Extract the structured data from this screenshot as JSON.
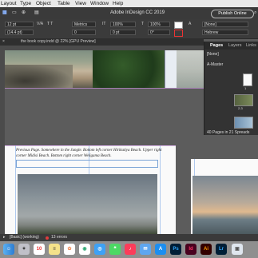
{
  "menubar": {
    "items": [
      "Layout",
      "Type",
      "Object",
      "Table",
      "View",
      "Window",
      "Help"
    ]
  },
  "titlebar": {
    "title": "Adobe InDesign CC 2019",
    "publish_label": "Publish Online"
  },
  "control": {
    "font_size": "12 pt",
    "leading": "(14.4 pt)",
    "kerning": "Metrics",
    "tracking": "0",
    "scale_v": "100%",
    "scale_h": "100%",
    "baseline": "0 pt",
    "skew": "0°",
    "char_style": "[None]",
    "language": "Hebrew"
  },
  "document_tab": {
    "label": "the book copy.indd @ 22% [GPU Preview]"
  },
  "pages_panel": {
    "tabs": [
      "Pages",
      "Layers",
      "Links"
    ],
    "none_label": "[None]",
    "master_label": "A-Master",
    "spread_label": "2-3",
    "page_count": "40 Pages in 21 Spreads"
  },
  "document": {
    "caption": "Previous Page. Somewhere in the Jungle. Bottom left corner Hirikatiya Beach. Upper right corner Midisi Beach. Bottom right corner Weligama Beach."
  },
  "status": {
    "style": "[Basic] (working)",
    "errors": "13 errors"
  },
  "dock": {
    "icons": [
      "finder-icon",
      "launchpad-icon",
      "calendar-icon",
      "notes-icon",
      "photos-icon",
      "chrome-icon",
      "safari-icon",
      "messages-icon",
      "music-icon",
      "mail-icon",
      "appstore-icon",
      "photoshop-icon",
      "indesign-icon",
      "illustrator-icon",
      "lightroom-icon",
      "preview-icon"
    ],
    "labels": {
      "calendar": "10",
      "photoshop": "Ps",
      "indesign": "Id",
      "illustrator": "Ai",
      "lightroom": "Lr"
    }
  },
  "colors": {
    "error_dot": "#e23c3c",
    "indesign": "#d1125e",
    "photoshop": "#31a8ff",
    "illustrator": "#ff9a00",
    "lightroom": "#2e5fa3"
  }
}
